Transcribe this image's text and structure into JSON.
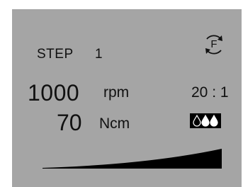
{
  "step": {
    "label": "STEP",
    "value": "1"
  },
  "speed": {
    "value": "1000",
    "unit": "rpm"
  },
  "torque": {
    "value": "70",
    "unit": "Ncm"
  },
  "ratio": {
    "value": "20 : 1"
  },
  "mode": {
    "letter": "F",
    "icon": "rotation-arrows-icon"
  },
  "coolant": {
    "level": 2,
    "max": 3,
    "icon": "coolant-drops-icon"
  },
  "colors": {
    "screen": "#a5a5a5",
    "ink": "#111111"
  }
}
